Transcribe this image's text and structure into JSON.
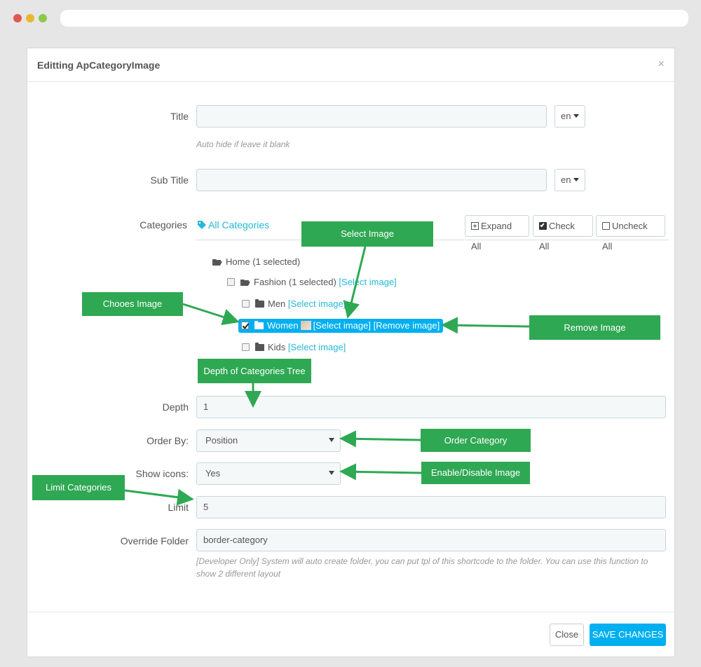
{
  "modal": {
    "title": "Editting ApCategoryImage",
    "close_glyph": "×"
  },
  "form": {
    "title_label": "Title",
    "title_value": "",
    "title_lang": "en",
    "title_help": "Auto hide if leave it blank",
    "subtitle_label": "Sub Title",
    "subtitle_value": "",
    "subtitle_lang": "en",
    "categories_label": "Categories",
    "all_categories": "All Categories",
    "expand_all": "Expand All",
    "check_all": "Check All",
    "uncheck_all": "Uncheck All",
    "depth_label": "Depth",
    "depth_value": "1",
    "order_label": "Order By:",
    "order_value": "Position",
    "icons_label": "Show icons:",
    "icons_value": "Yes",
    "limit_label": "Limit",
    "limit_value": "5",
    "override_label": "Override Folder",
    "override_value": "border-category",
    "override_help": "[Developer Only] System will auto create folder, you can put tpl of this shortcode to the folder. You can use this function to show 2 different layout"
  },
  "tree": {
    "home": "Home (1 selected)",
    "fashion": "Fashion (1 selected)",
    "men": "Men",
    "women": "Women",
    "kids": "Kids",
    "select_image": "[Select image]",
    "remove_image": "[Remove image]"
  },
  "footer": {
    "close": "Close",
    "save": "SAVE CHANGES"
  },
  "callouts": {
    "select_image": "Select Image",
    "choose_image": "Chooes Image",
    "remove_image": "Remove Image",
    "depth_tree": "Depth of Categories Tree",
    "order_category": "Order Category",
    "enable_disable": "Enable/Disable Image",
    "limit_categories": "Limit Categories"
  },
  "colors": {
    "accent": "#25b9d7",
    "primary_button": "#00aff0",
    "callout": "#2fa853"
  }
}
